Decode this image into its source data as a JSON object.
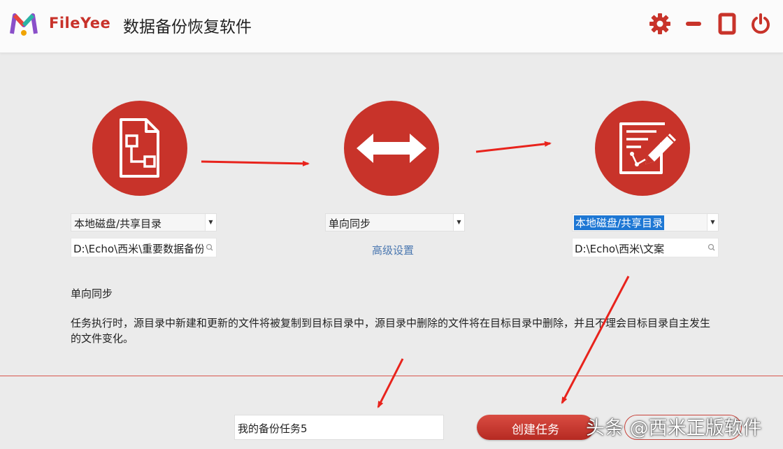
{
  "titlebar": {
    "brand": "FileYee",
    "app_title": "数据备份恢复软件",
    "buttons": {
      "settings": "gear-icon",
      "minimize": "minimize-icon",
      "maximize": "maximize-icon",
      "close": "power-icon"
    }
  },
  "steps": {
    "source": {
      "icon": "source-document-icon",
      "type_select": "本地磁盘/共享目录",
      "path": "D:\\Echo\\西米\\重要数据备份"
    },
    "sync": {
      "icon": "double-arrow-icon",
      "mode_select": "单向同步",
      "advanced_link": "高级设置"
    },
    "target": {
      "icon": "edit-document-icon",
      "type_select": "本地磁盘/共享目录",
      "path": "D:\\Echo\\西米\\文案"
    }
  },
  "description": {
    "title": "单向同步",
    "text": "任务执行时，源目录中新建和更新的文件将被复制到目标目录中，源目录中删除的文件将在目标目录中删除，并且不理会目标目录自主发生的文件变化。"
  },
  "footer": {
    "task_name": "我的备份任务5",
    "create_button": "创建任务"
  },
  "watermark": "头条 @西米正版软件",
  "colors": {
    "accent": "#c8332a",
    "link": "#4a77b0",
    "selection": "#1d77d4",
    "annotation_arrow": "#e8231c"
  }
}
